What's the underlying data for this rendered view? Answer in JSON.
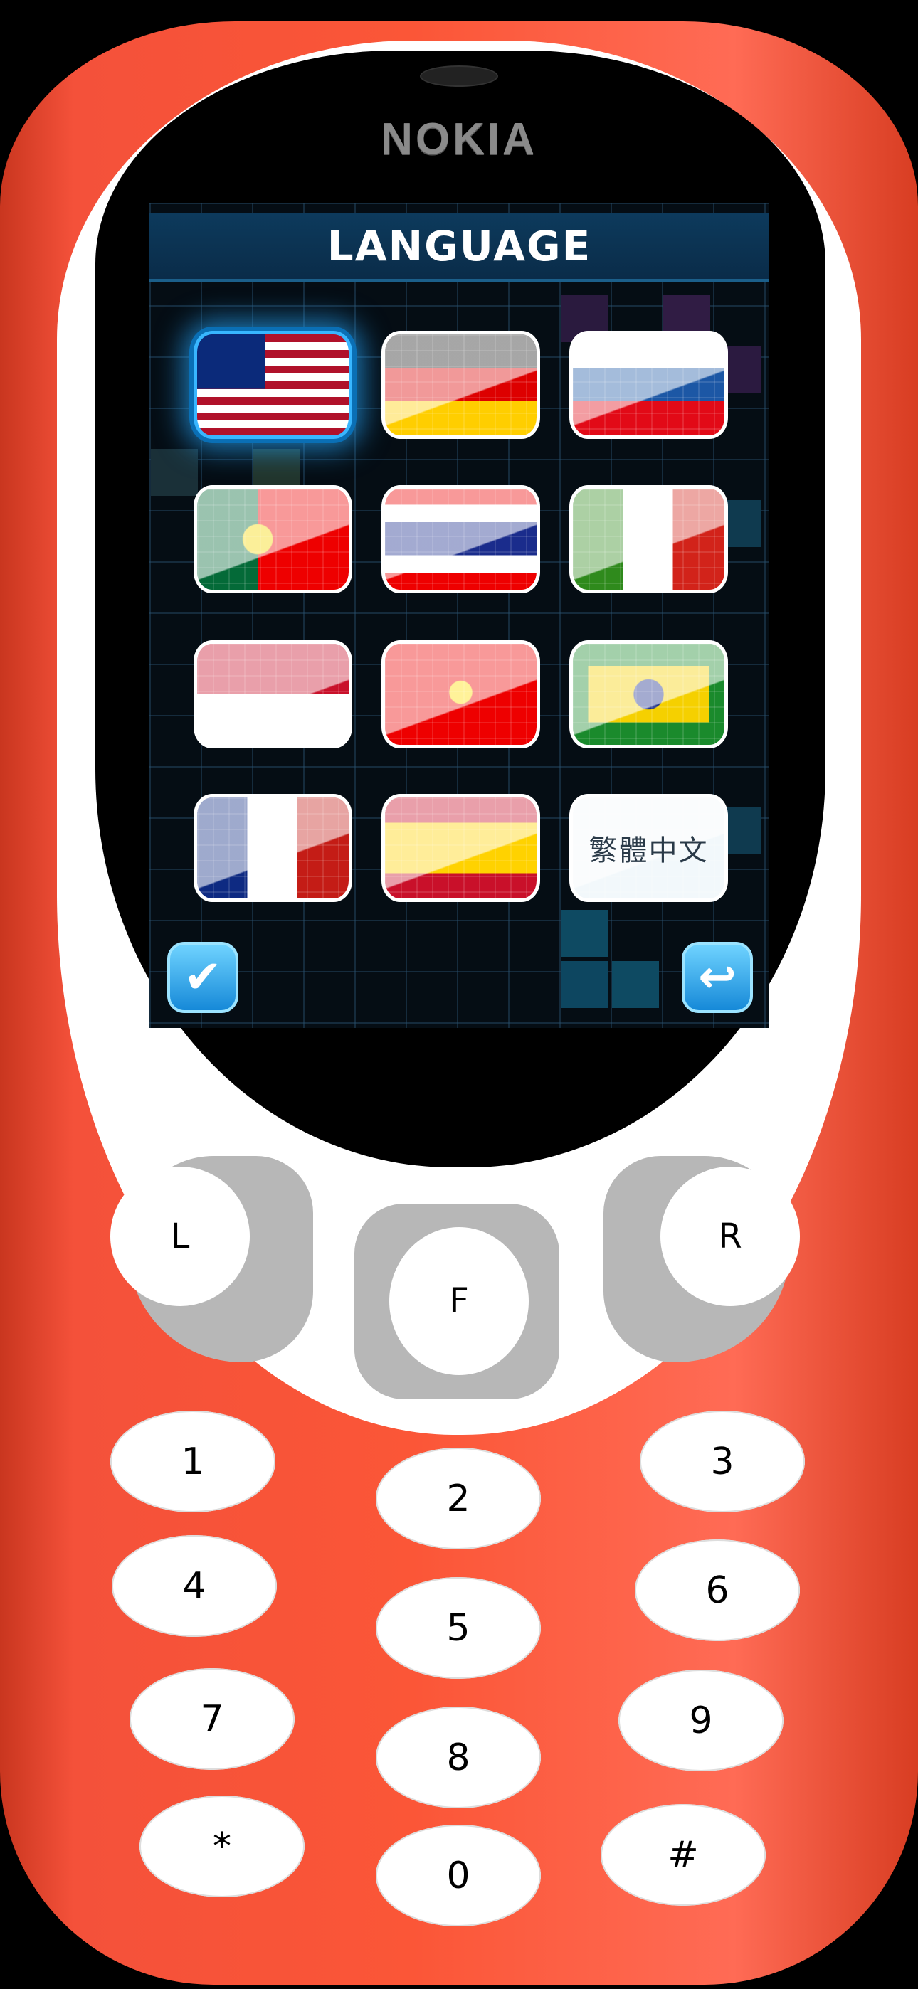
{
  "device": {
    "brand": "NOKIA",
    "body_color": "#fb5637"
  },
  "screen": {
    "title": "LANGUAGE",
    "selected_index": 0,
    "languages": [
      {
        "flag": "usa"
      },
      {
        "flag": "germany"
      },
      {
        "flag": "russia"
      },
      {
        "flag": "portugal"
      },
      {
        "flag": "thailand"
      },
      {
        "flag": "italy"
      },
      {
        "flag": "indonesia"
      },
      {
        "flag": "vietnam"
      },
      {
        "flag": "brazil"
      },
      {
        "flag": "france"
      },
      {
        "flag": "spain"
      },
      {
        "flag": "none",
        "label": "繁體中文"
      }
    ],
    "confirm_icon": "checkmark-icon",
    "back_icon": "back-arrow-icon",
    "accent": "#38b6ff"
  },
  "softkeys": {
    "left": "L",
    "center": "F",
    "right": "R"
  },
  "keypad": [
    "1",
    "2",
    "3",
    "4",
    "5",
    "6",
    "7",
    "8",
    "9",
    "*",
    "0",
    "#"
  ]
}
